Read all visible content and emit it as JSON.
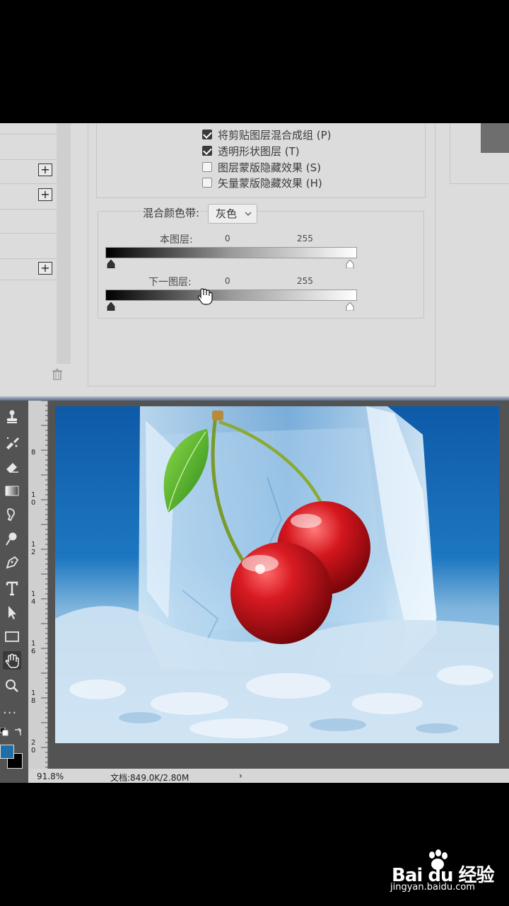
{
  "dialog": {
    "options": [
      {
        "label": "将剪贴图层混合成组 (P)",
        "checked": true
      },
      {
        "label": "透明形状图层 (T)",
        "checked": true
      },
      {
        "label": "图层蒙版隐藏效果 (S)",
        "checked": false
      },
      {
        "label": "矢量蒙版隐藏效果 (H)",
        "checked": false
      }
    ],
    "blend_if": {
      "label": "混合颜色带:",
      "selected": "灰色",
      "this_layer": {
        "label": "本图层:",
        "min": "0",
        "max": "255"
      },
      "underlying_layer": {
        "label": "下一图层:",
        "min": "0",
        "max": "255"
      }
    }
  },
  "toolbar": {
    "tools": [
      "stamp-icon",
      "healing-brush-icon",
      "eraser-icon",
      "gradient-icon",
      "blur-icon",
      "dodge-icon",
      "pen-icon",
      "type-icon",
      "path-select-icon",
      "rectangle-icon",
      "hand-icon",
      "zoom-icon"
    ],
    "more": "...",
    "active_tool": "hand-icon",
    "foreground_color": "#1d6fa6",
    "background_color": "#000000"
  },
  "ruler": {
    "numbers": [
      "8",
      "1\n0",
      "1\n2",
      "1\n4",
      "1\n6",
      "1\n8",
      "2\n0"
    ]
  },
  "status": {
    "zoom": "91.8%",
    "doc": "文档:849.0K/2.80M",
    "arrow": "›"
  },
  "watermark": {
    "brand": "Bai du 经验",
    "url": "jingyan.baidu.com"
  }
}
